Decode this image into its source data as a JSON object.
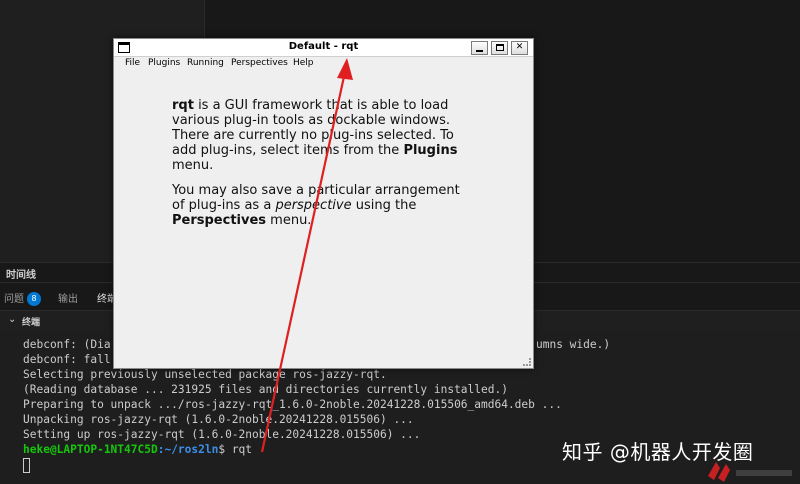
{
  "vscode": {
    "timeline_label": "时间线",
    "tabs": [
      {
        "label": "问题",
        "badge": "8"
      },
      {
        "label": "输出"
      },
      {
        "label": "终端"
      }
    ],
    "terminal_header": "终端"
  },
  "terminal": {
    "lines": [
      "debconf: (Dia",
      "debconf: fall",
      "Selecting previously unselected package ros-jazzy-rqt.",
      "(Reading database ... 231925 files and directories currently installed.)",
      "Preparing to unpack .../ros-jazzy-rqt_1.6.0-2noble.20241228.015506_amd64.deb ...",
      "Unpacking ros-jazzy-rqt (1.6.0-2noble.20241228.015506) ...",
      "Setting up ros-jazzy-rqt (1.6.0-2noble.20241228.015506) ..."
    ],
    "line1_tail": "umns wide.)",
    "prompt_user": "heke@LAPTOP-1NT47C5D",
    "prompt_path": ":~/ros2ln",
    "prompt_cmd": "$ rqt"
  },
  "rqt": {
    "title": "Default - rqt",
    "menu": [
      "File",
      "Plugins",
      "Running",
      "Perspectives",
      "Help"
    ],
    "para1": {
      "b1": "rqt",
      "t1": " is a GUI framework that is able to load various plug-in tools as dockable windows. There are currently no plug-ins selected. To add plug-ins, select items from the ",
      "b2": "Plugins",
      "t2": " menu."
    },
    "para2": {
      "t1": "You may also save a particular arrangement of plug-ins as a ",
      "i1": "perspective",
      "t2": " using the ",
      "b1": "Perspectives",
      "t3": " menu."
    }
  },
  "watermark": "知乎 @机器人开发圈",
  "colors": {
    "arrow": "#e02020",
    "prompt_user": "#16c60c",
    "prompt_path": "#3b8eea",
    "badge": "#0078d4"
  }
}
